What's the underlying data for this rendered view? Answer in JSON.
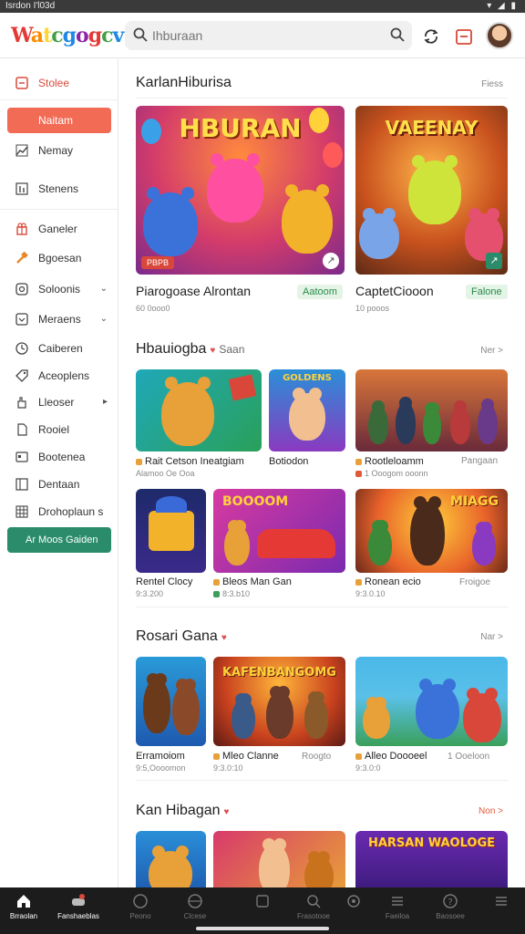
{
  "status_bar": {
    "left": "Isrdon I'l03d",
    "right": "▾ ◢ ▮"
  },
  "header": {
    "logo_letters": [
      "W",
      "a",
      "t",
      "c",
      "g",
      "o",
      "g",
      "c",
      "v"
    ],
    "search_placeholder": "Ihburaan"
  },
  "sidebar": {
    "items": [
      {
        "label": "Stolee",
        "icon": "square-minus-icon"
      },
      {
        "label": "Naitam",
        "icon": "play-icon"
      },
      {
        "label": "Nemay",
        "icon": "trend-icon"
      },
      {
        "label": "Stenens",
        "icon": "chart-icon"
      },
      {
        "label": "Ganeler",
        "icon": "gift-icon"
      },
      {
        "label": "Bgoesan",
        "icon": "hammer-icon"
      },
      {
        "label": "Soloonis",
        "icon": "shield-icon"
      },
      {
        "label": "Meraens",
        "icon": "square-icon"
      },
      {
        "label": "Caiberen",
        "icon": "clock-icon"
      },
      {
        "label": "Aceoplens",
        "icon": "tag-icon"
      },
      {
        "label": "Lleoser",
        "icon": "hand-icon"
      },
      {
        "label": "Rooiel",
        "icon": "doc-icon"
      },
      {
        "label": "Bootenea",
        "icon": "card-icon"
      },
      {
        "label": "Dentaan",
        "icon": "window-icon"
      },
      {
        "label": "Drohoplaun s",
        "icon": "grid-icon"
      }
    ],
    "cta_label": "Ar Moos Gaiden"
  },
  "sections": [
    {
      "title": "KarlanHiburisa",
      "more": "Fiess",
      "featured": [
        {
          "art_title": "HBURAN",
          "badge": "PBPB",
          "name": "Piarogoase Alrontan",
          "tag": "Aatoom",
          "meta": "60 0ooo0"
        },
        {
          "art_title": "VAEENAY",
          "name": "CaptetCiooon",
          "tag": "Falone",
          "meta": "10 pooos"
        }
      ]
    },
    {
      "title": "Hbauiogba",
      "subtitle": "Saan",
      "more": "Ner >",
      "grid": [
        {
          "name": "Rait Cetson Ineatgiam",
          "meta": "Alamoo Oe Ooa"
        },
        {
          "name": "Botiodon",
          "meta": ""
        },
        {
          "name": "Rootleloamm",
          "meta": "1 Ooogom ooonn",
          "extra": "Pangaan"
        },
        {
          "name": "Rentel Clocy",
          "meta": "9:3.200"
        },
        {
          "name": "Bleos Man Gan",
          "meta": "8:3.b10"
        },
        {
          "name": "Ronean ecio",
          "meta": "9:3.0.10",
          "extra": "Froigoe"
        }
      ]
    },
    {
      "title": "Rosari Gana",
      "more": "Nar >",
      "grid": [
        {
          "name": "Erramoiom",
          "meta": "9:5,Oooomon"
        },
        {
          "name": "Mleo Clanne",
          "meta": "9:3.0:10",
          "extra": "Roogto"
        },
        {
          "name": "Alleo Doooeel",
          "meta": "9:3.0:0",
          "extra": "1 Ooeloon"
        }
      ]
    },
    {
      "title": "Kan Hibagan",
      "more": "Non >"
    }
  ],
  "art_titles": {
    "tile2": "GOLDENS",
    "tile5": "BOOOOM",
    "tile6": "MIAGG",
    "tile8": "KAFENBANGOMG",
    "tile11": "HARSAN WAOLOGE"
  },
  "bottom_nav": [
    {
      "label": "Brraolan",
      "icon": "home-icon"
    },
    {
      "label": "Fanshaeblas",
      "icon": "game-icon"
    },
    {
      "label": "Peono",
      "icon": "globe-icon"
    },
    {
      "label": "Clcese",
      "icon": "ball-icon"
    },
    {
      "label": "",
      "icon": "layers-icon"
    },
    {
      "label": "Frasotooe",
      "icon": "search-icon"
    },
    {
      "label": "",
      "icon": "settings-icon"
    },
    {
      "label": "Faeiloa",
      "icon": "list-icon"
    },
    {
      "label": "Baosoee",
      "icon": "help-icon"
    },
    {
      "label": "",
      "icon": "menu-icon"
    }
  ]
}
